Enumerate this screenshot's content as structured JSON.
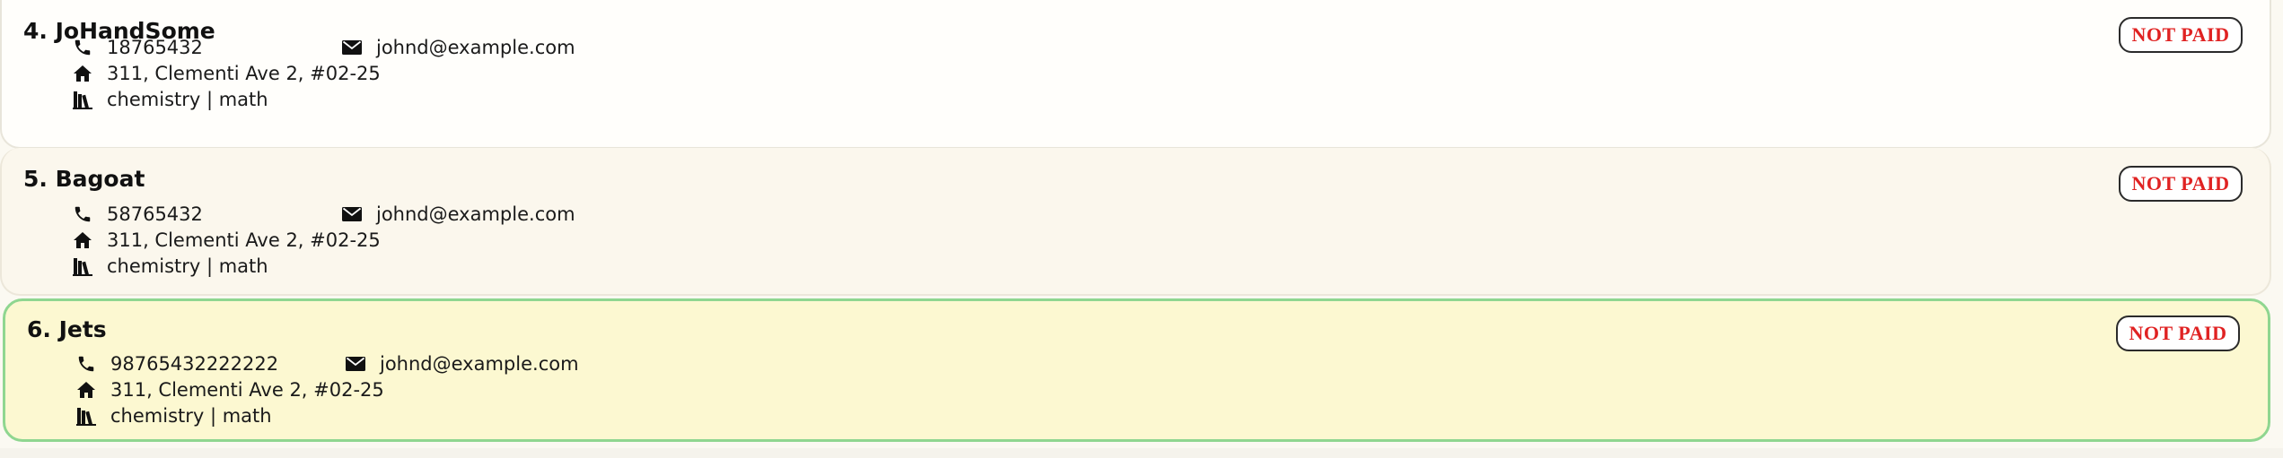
{
  "persons": [
    {
      "name": "4. JoHandSome",
      "phone": "18765432",
      "email": "johnd@example.com",
      "address": "311, Clementi Ave 2, #02-25",
      "subjects": "chemistry | math",
      "status": "NOT PAID",
      "selected": false
    },
    {
      "name": "5. Bagoat",
      "phone": "58765432",
      "email": "johnd@example.com",
      "address": "311, Clementi Ave 2, #02-25",
      "subjects": "chemistry | math",
      "status": "NOT PAID",
      "selected": false
    },
    {
      "name": "6. Jets",
      "phone": "98765432222222",
      "email": "johnd@example.com",
      "address": "311, Clementi Ave 2, #02-25",
      "subjects": "chemistry | math",
      "status": "NOT PAID",
      "selected": true
    }
  ],
  "icons": {
    "phone": "phone-icon",
    "email": "envelope-icon",
    "address": "home-icon",
    "subjects": "books-icon"
  },
  "colors": {
    "not_paid": "#e02222",
    "selected_border": "#8fd690",
    "selected_background": "#fcf8d1"
  }
}
